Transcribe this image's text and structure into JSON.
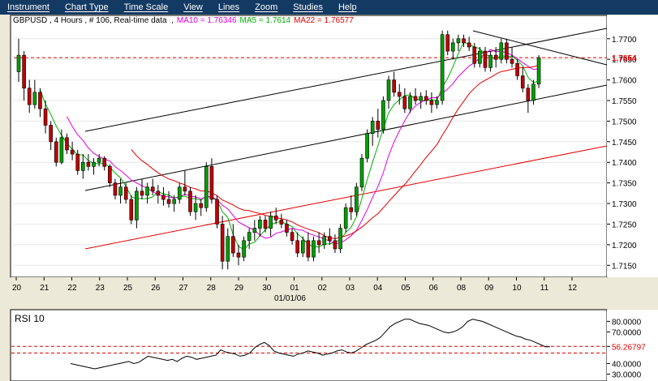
{
  "menu": [
    "Instrument",
    "Chart Type",
    "Time Scale",
    "View",
    "Lines",
    "Zoom",
    "Studies",
    "Help"
  ],
  "header": {
    "symbol": "GBPUSD",
    "sep1": " , 4 Hours , # 106, Real-time data  ,",
    "ma10": "MA10 = 1.76346",
    "ma5": "MA5 = 1.7614",
    "ma22": "MA22 = 1.76577",
    "colors": {
      "ma10": "#e000e0",
      "ma5": "#00b000",
      "ma22": "#e00000"
    }
  },
  "price_axis": {
    "ticks": [
      "1.7700",
      "1.7650",
      "1.7600",
      "1.7550",
      "1.7500",
      "1.7450",
      "1.7400",
      "1.7350",
      "1.7300",
      "1.7250",
      "1.7200",
      "1.7150"
    ],
    "current_price": "1.7654",
    "current_price_value": 1.7654
  },
  "date_axis": {
    "labels": [
      "20",
      "21",
      "22",
      "23",
      "25",
      "26",
      "27",
      "28",
      "29",
      "30",
      "01",
      "02",
      "03",
      "04",
      "05",
      "06",
      "08",
      "09",
      "10",
      "11",
      "12"
    ],
    "sub_label": "01/01/06"
  },
  "rsi_panel": {
    "title": "RSI 10",
    "ticks": [
      "80.0000",
      "70.0000",
      "56.26797",
      "40.0000",
      "30.0000"
    ],
    "current_value": "56.26797",
    "levels": [
      56.26797,
      50
    ]
  },
  "chart_data": {
    "type": "candlestick",
    "symbol": "GBPUSD",
    "timeframe": "4 Hours",
    "y_range": [
      1.7125,
      1.7735
    ],
    "candles": [
      [
        1.762,
        1.77,
        1.7595,
        1.766
      ],
      [
        1.766,
        1.767,
        1.755,
        1.758
      ],
      [
        1.758,
        1.76,
        1.752,
        1.754
      ],
      [
        1.754,
        1.76,
        1.753,
        1.757
      ],
      [
        1.757,
        1.758,
        1.751,
        1.753
      ],
      [
        1.753,
        1.755,
        1.747,
        1.749
      ],
      [
        1.749,
        1.75,
        1.743,
        1.745
      ],
      [
        1.745,
        1.746,
        1.739,
        1.74
      ],
      [
        1.74,
        1.748,
        1.7395,
        1.746
      ],
      [
        1.746,
        1.747,
        1.742,
        1.743
      ],
      [
        1.743,
        1.745,
        1.7405,
        1.742
      ],
      [
        1.742,
        1.743,
        1.737,
        1.738
      ],
      [
        1.738,
        1.742,
        1.736,
        1.74
      ],
      [
        1.74,
        1.742,
        1.738,
        1.739
      ],
      [
        1.739,
        1.741,
        1.737,
        1.74
      ],
      [
        1.74,
        1.742,
        1.739,
        1.741
      ],
      [
        1.741,
        1.7415,
        1.738,
        1.739
      ],
      [
        1.739,
        1.7395,
        1.734,
        1.735
      ],
      [
        1.735,
        1.736,
        1.731,
        1.732
      ],
      [
        1.732,
        1.736,
        1.73,
        1.734
      ],
      [
        1.734,
        1.735,
        1.73,
        1.731
      ],
      [
        1.731,
        1.732,
        1.725,
        1.726
      ],
      [
        1.726,
        1.734,
        1.724,
        1.733
      ],
      [
        1.733,
        1.736,
        1.731,
        1.732
      ],
      [
        1.732,
        1.735,
        1.73,
        1.734
      ],
      [
        1.734,
        1.736,
        1.732,
        1.733
      ],
      [
        1.733,
        1.7345,
        1.73,
        1.732
      ],
      [
        1.732,
        1.734,
        1.7295,
        1.731
      ],
      [
        1.731,
        1.733,
        1.729,
        1.73
      ],
      [
        1.73,
        1.732,
        1.728,
        1.731
      ],
      [
        1.731,
        1.735,
        1.73,
        1.734
      ],
      [
        1.734,
        1.738,
        1.732,
        1.733
      ],
      [
        1.733,
        1.734,
        1.727,
        1.728
      ],
      [
        1.728,
        1.732,
        1.726,
        1.73
      ],
      [
        1.73,
        1.731,
        1.727,
        1.729
      ],
      [
        1.729,
        1.74,
        1.728,
        1.739
      ],
      [
        1.739,
        1.741,
        1.73,
        1.731
      ],
      [
        1.731,
        1.732,
        1.724,
        1.725
      ],
      [
        1.725,
        1.727,
        1.714,
        1.716
      ],
      [
        1.716,
        1.724,
        1.714,
        1.722
      ],
      [
        1.722,
        1.725,
        1.717,
        1.718
      ],
      [
        1.718,
        1.72,
        1.715,
        1.717
      ],
      [
        1.717,
        1.722,
        1.716,
        1.721
      ],
      [
        1.721,
        1.724,
        1.719,
        1.723
      ],
      [
        1.723,
        1.726,
        1.721,
        1.724
      ],
      [
        1.724,
        1.727,
        1.722,
        1.726
      ],
      [
        1.726,
        1.727,
        1.723,
        1.724
      ],
      [
        1.724,
        1.728,
        1.722,
        1.727
      ],
      [
        1.727,
        1.729,
        1.725,
        1.726
      ],
      [
        1.726,
        1.7275,
        1.724,
        1.725
      ],
      [
        1.725,
        1.726,
        1.722,
        1.723
      ],
      [
        1.723,
        1.724,
        1.72,
        1.721
      ],
      [
        1.721,
        1.723,
        1.717,
        1.718
      ],
      [
        1.718,
        1.722,
        1.717,
        1.721
      ],
      [
        1.721,
        1.723,
        1.716,
        1.717
      ],
      [
        1.717,
        1.722,
        1.716,
        1.721
      ],
      [
        1.721,
        1.723,
        1.718,
        1.72
      ],
      [
        1.72,
        1.723,
        1.719,
        1.722
      ],
      [
        1.722,
        1.724,
        1.72,
        1.721
      ],
      [
        1.721,
        1.7225,
        1.718,
        1.719
      ],
      [
        1.719,
        1.725,
        1.718,
        1.724
      ],
      [
        1.724,
        1.73,
        1.723,
        1.729
      ],
      [
        1.729,
        1.732,
        1.726,
        1.728
      ],
      [
        1.728,
        1.735,
        1.727,
        1.734
      ],
      [
        1.734,
        1.742,
        1.733,
        1.741
      ],
      [
        1.741,
        1.748,
        1.74,
        1.747
      ],
      [
        1.747,
        1.751,
        1.744,
        1.75
      ],
      [
        1.75,
        1.753,
        1.746,
        1.748
      ],
      [
        1.748,
        1.756,
        1.747,
        1.755
      ],
      [
        1.755,
        1.761,
        1.753,
        1.76
      ],
      [
        1.76,
        1.762,
        1.756,
        1.757
      ],
      [
        1.757,
        1.759,
        1.754,
        1.756
      ],
      [
        1.756,
        1.758,
        1.752,
        1.753
      ],
      [
        1.753,
        1.757,
        1.752,
        1.756
      ],
      [
        1.756,
        1.758,
        1.754,
        1.755
      ],
      [
        1.755,
        1.757,
        1.753,
        1.756
      ],
      [
        1.756,
        1.7575,
        1.754,
        1.755
      ],
      [
        1.755,
        1.757,
        1.752,
        1.754
      ],
      [
        1.754,
        1.756,
        1.753,
        1.755
      ],
      [
        1.755,
        1.772,
        1.754,
        1.771
      ],
      [
        1.771,
        1.772,
        1.766,
        1.767
      ],
      [
        1.767,
        1.77,
        1.765,
        1.769
      ],
      [
        1.769,
        1.771,
        1.767,
        1.77
      ],
      [
        1.77,
        1.771,
        1.768,
        1.769
      ],
      [
        1.769,
        1.7705,
        1.767,
        1.768
      ],
      [
        1.768,
        1.769,
        1.763,
        1.764
      ],
      [
        1.764,
        1.768,
        1.763,
        1.767
      ],
      [
        1.767,
        1.768,
        1.762,
        1.763
      ],
      [
        1.763,
        1.767,
        1.762,
        1.766
      ],
      [
        1.766,
        1.768,
        1.763,
        1.765
      ],
      [
        1.765,
        1.77,
        1.764,
        1.769
      ],
      [
        1.769,
        1.77,
        1.764,
        1.765
      ],
      [
        1.765,
        1.768,
        1.763,
        1.764
      ],
      [
        1.764,
        1.765,
        1.76,
        1.761
      ],
      [
        1.761,
        1.763,
        1.757,
        1.758
      ],
      [
        1.758,
        1.759,
        1.752,
        1.755
      ],
      [
        1.755,
        1.76,
        1.754,
        1.759
      ],
      [
        1.759,
        1.766,
        1.758,
        1.7654
      ]
    ],
    "moving_averages": [
      {
        "name": "MA10",
        "value": 1.76346,
        "color": "#e000e0"
      },
      {
        "name": "MA5",
        "value": 1.7614,
        "color": "#00b000"
      },
      {
        "name": "MA22",
        "value": 1.76577,
        "color": "#e00000"
      }
    ],
    "rsi_period": 10,
    "rsi_range": [
      25,
      88
    ],
    "rsi_values": [
      40,
      39,
      38,
      37,
      36,
      35,
      36,
      37,
      38,
      39,
      40,
      41,
      42,
      40,
      41,
      44,
      47,
      46,
      45,
      44,
      43,
      44,
      42,
      45,
      47,
      46,
      44,
      45,
      46,
      47,
      48,
      53,
      51,
      50,
      49,
      47,
      48,
      50,
      55,
      58,
      60,
      57,
      52,
      50,
      49,
      48,
      47,
      49,
      50,
      52,
      51,
      50,
      48,
      49,
      50,
      52,
      53,
      51,
      50,
      52,
      55,
      58,
      60,
      62,
      65,
      70,
      75,
      78,
      80,
      82,
      82,
      80,
      78,
      77,
      76,
      74,
      72,
      70,
      69,
      70,
      72,
      75,
      80,
      82,
      81,
      80,
      78,
      76,
      74,
      72,
      70,
      68,
      66,
      65,
      63,
      62,
      60,
      58,
      56,
      56
    ]
  }
}
